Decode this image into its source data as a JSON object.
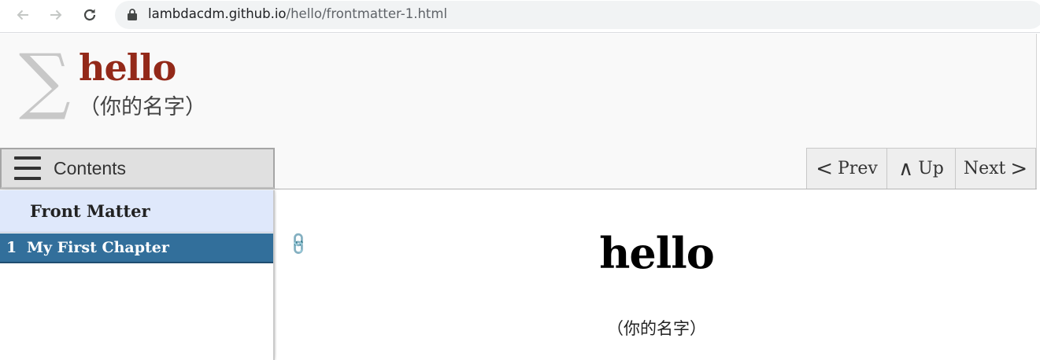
{
  "browser": {
    "url_host": "lambdacdm.github.io",
    "url_path": "/hello/frontmatter-1.html",
    "icons": [
      "back-arrow-icon",
      "forward-arrow-icon",
      "reload-icon",
      "lock-icon"
    ]
  },
  "masthead": {
    "logo_symbol": "∑",
    "title": "hello",
    "subtitle": "（你的名字）"
  },
  "toc_toggle": {
    "label": "Contents",
    "icon": "hamburger-icon"
  },
  "pager": {
    "prev_glyph": "<",
    "prev_label": "Prev",
    "up_glyph": "∧",
    "up_label": "Up",
    "next_label": "Next",
    "next_glyph": ">"
  },
  "toc": {
    "front_matter": "Front Matter",
    "chapters": [
      {
        "number": "1",
        "title": "My First Chapter"
      }
    ]
  },
  "content": {
    "heading": "hello",
    "author": "（你的名字）"
  },
  "colors": {
    "title": "#932919",
    "toc_active": "#326f9b",
    "toc_frontmatter": "#dfe8fb"
  }
}
